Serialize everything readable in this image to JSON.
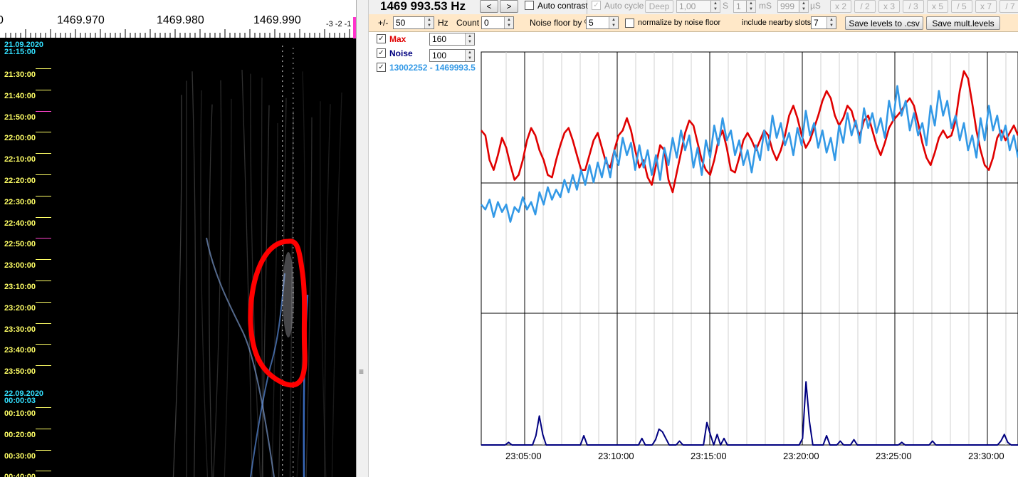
{
  "waterfall": {
    "freq_labels": [
      "0",
      "1469.970",
      "1469.980",
      "1469.990",
      "-3 -2 -1"
    ],
    "dates": [
      {
        "date": "21.09.2020",
        "time": "21:15:00"
      },
      {
        "date": "22.09.2020",
        "time": "00:00:03"
      }
    ],
    "times": [
      "21:30:00",
      "21:40:00",
      "21:50:00",
      "22:00:00",
      "22:10:00",
      "22:20:00",
      "22:30:00",
      "22:40:00",
      "22:50:00",
      "23:00:00",
      "23:10:00",
      "23:20:00",
      "23:30:00",
      "23:40:00",
      "23:50:00",
      "00:10:00",
      "00:20:00",
      "00:30:00",
      "00:40:00"
    ],
    "highlight_color": "#ff0000"
  },
  "toolbar": {
    "frequency": "1469 993.53 Hz",
    "prev": "<",
    "next": ">",
    "auto_contrast": "Auto contrast",
    "auto_cycle": "Auto cycle",
    "deep": "Deep",
    "deep_val": "1,00",
    "unit_s": "S",
    "ms_val": "1",
    "unit_ms": "mS",
    "us_val": "999",
    "unit_us": "µS",
    "zoom": [
      "x 2",
      "/ 2",
      "x 3",
      "/ 3",
      "x 5",
      "/ 5",
      "x 7",
      "/ 7"
    ]
  },
  "settings": {
    "pm_label": "+/-",
    "pm_value": "50",
    "hz": "Hz",
    "count_label": "Count",
    "count_value": "0",
    "noise_floor_label": "Noise floor by %",
    "noise_floor_value": "5",
    "normalize_label": "normalize by noise floor",
    "nearby_label": "include nearby slots:",
    "nearby_value": "7",
    "save_csv": "Save levels to .csv",
    "save_mult": "Save mult.levels"
  },
  "legend": {
    "max_label": "Max",
    "max_value": "160",
    "noise_label": "Noise",
    "noise_value": "100",
    "series_label": "13002252 - 1469993.5",
    "colors": {
      "max": "#e00000",
      "noise": "#000080",
      "series": "#3399e6"
    }
  },
  "chart_data": {
    "type": "line",
    "x_ticks": [
      "23:05:00",
      "23:10:00",
      "23:15:00",
      "23:20:00",
      "23:25:00",
      "23:30:00"
    ],
    "x_range": [
      "23:02:40",
      "23:31:40"
    ],
    "grid": true,
    "series": [
      {
        "name": "Max",
        "color": "#e00000",
        "values": [
          0.74,
          0.72,
          0.62,
          0.58,
          0.64,
          0.71,
          0.67,
          0.6,
          0.54,
          0.56,
          0.62,
          0.7,
          0.75,
          0.72,
          0.66,
          0.62,
          0.56,
          0.55,
          0.62,
          0.68,
          0.73,
          0.75,
          0.7,
          0.64,
          0.58,
          0.58,
          0.64,
          0.7,
          0.73,
          0.67,
          0.61,
          0.59,
          0.66,
          0.72,
          0.74,
          0.79,
          0.74,
          0.66,
          0.59,
          0.62,
          0.55,
          0.52,
          0.6,
          0.68,
          0.66,
          0.54,
          0.49,
          0.57,
          0.65,
          0.73,
          0.78,
          0.76,
          0.69,
          0.62,
          0.58,
          0.56,
          0.62,
          0.7,
          0.74,
          0.67,
          0.58,
          0.57,
          0.63,
          0.7,
          0.73,
          0.7,
          0.66,
          0.7,
          0.74,
          0.72,
          0.66,
          0.62,
          0.66,
          0.72,
          0.8,
          0.84,
          0.79,
          0.72,
          0.67,
          0.7,
          0.75,
          0.8,
          0.86,
          0.9,
          0.87,
          0.8,
          0.76,
          0.79,
          0.84,
          0.82,
          0.76,
          0.72,
          0.78,
          0.8,
          0.74,
          0.68,
          0.64,
          0.69,
          0.75,
          0.78,
          0.8,
          0.82,
          0.85,
          0.87,
          0.84,
          0.77,
          0.69,
          0.63,
          0.6,
          0.65,
          0.71,
          0.74,
          0.71,
          0.72,
          0.78,
          0.9,
          0.98,
          0.95,
          0.85,
          0.74,
          0.66,
          0.6,
          0.58,
          0.63,
          0.71,
          0.74,
          0.7,
          0.73,
          0.76,
          0.72
        ]
      },
      {
        "name": "13002252 - 1469993.5",
        "color": "#3399e6",
        "values": [
          0.44,
          0.42,
          0.46,
          0.39,
          0.45,
          0.41,
          0.44,
          0.37,
          0.43,
          0.41,
          0.47,
          0.42,
          0.45,
          0.4,
          0.49,
          0.44,
          0.51,
          0.46,
          0.5,
          0.47,
          0.54,
          0.49,
          0.56,
          0.5,
          0.58,
          0.52,
          0.6,
          0.53,
          0.61,
          0.55,
          0.63,
          0.55,
          0.66,
          0.6,
          0.71,
          0.64,
          0.69,
          0.58,
          0.68,
          0.59,
          0.66,
          0.56,
          0.64,
          0.54,
          0.67,
          0.6,
          0.71,
          0.63,
          0.74,
          0.66,
          0.72,
          0.59,
          0.67,
          0.56,
          0.7,
          0.63,
          0.76,
          0.68,
          0.79,
          0.7,
          0.74,
          0.64,
          0.7,
          0.6,
          0.66,
          0.57,
          0.68,
          0.62,
          0.74,
          0.66,
          0.8,
          0.71,
          0.77,
          0.68,
          0.73,
          0.64,
          0.75,
          0.68,
          0.82,
          0.72,
          0.77,
          0.67,
          0.74,
          0.65,
          0.71,
          0.62,
          0.76,
          0.69,
          0.81,
          0.72,
          0.78,
          0.69,
          0.83,
          0.75,
          0.81,
          0.73,
          0.79,
          0.71,
          0.86,
          0.78,
          0.92,
          0.8,
          0.86,
          0.74,
          0.81,
          0.72,
          0.77,
          0.68,
          0.84,
          0.76,
          0.9,
          0.8,
          0.86,
          0.75,
          0.8,
          0.7,
          0.77,
          0.66,
          0.72,
          0.63,
          0.79,
          0.7,
          0.84,
          0.74,
          0.8,
          0.7,
          0.76,
          0.66,
          0.72,
          0.63
        ]
      },
      {
        "name": "Noise",
        "color": "#000080",
        "values": [
          0.0,
          0.0,
          0.0,
          0.0,
          0.0,
          0.0,
          0.0,
          0.0,
          0.02,
          0.0,
          0.0,
          0.0,
          0.0,
          0.0,
          0.0,
          0.0,
          0.07,
          0.22,
          0.08,
          0.0,
          0.0,
          0.0,
          0.0,
          0.0,
          0.0,
          0.0,
          0.0,
          0.0,
          0.0,
          0.0,
          0.07,
          0.0,
          0.0,
          0.0,
          0.0,
          0.0,
          0.0,
          0.0,
          0.0,
          0.0,
          0.0,
          0.0,
          0.0,
          0.0,
          0.0,
          0.0,
          0.0,
          0.05,
          0.0,
          0.0,
          0.0,
          0.04,
          0.12,
          0.1,
          0.05,
          0.0,
          0.0,
          0.0,
          0.03,
          0.0,
          0.0,
          0.0,
          0.0,
          0.0,
          0.0,
          0.0,
          0.17,
          0.08,
          0.0,
          0.08,
          0.0,
          0.05,
          0.0,
          0.0,
          0.0,
          0.0,
          0.0,
          0.0,
          0.0,
          0.0,
          0.0,
          0.0,
          0.0,
          0.0,
          0.0,
          0.0,
          0.0,
          0.0,
          0.0,
          0.0,
          0.0,
          0.0,
          0.0,
          0.0,
          0.05,
          0.48,
          0.18,
          0.0,
          0.0,
          0.0,
          0.0,
          0.07,
          0.0,
          0.0,
          0.0,
          0.03,
          0.0,
          0.0,
          0.0,
          0.04,
          0.0,
          0.0,
          0.0,
          0.0,
          0.0,
          0.0,
          0.0,
          0.0,
          0.0,
          0.0,
          0.0,
          0.0,
          0.0,
          0.02,
          0.0,
          0.0,
          0.0,
          0.0,
          0.0,
          0.0,
          0.0,
          0.0,
          0.03,
          0.0,
          0.0,
          0.0,
          0.0,
          0.0,
          0.0,
          0.0,
          0.0,
          0.0,
          0.0,
          0.0,
          0.0,
          0.0,
          0.0,
          0.0,
          0.0,
          0.0,
          0.0,
          0.0,
          0.03,
          0.08,
          0.02,
          0.0,
          0.0,
          0.0
        ]
      }
    ]
  }
}
